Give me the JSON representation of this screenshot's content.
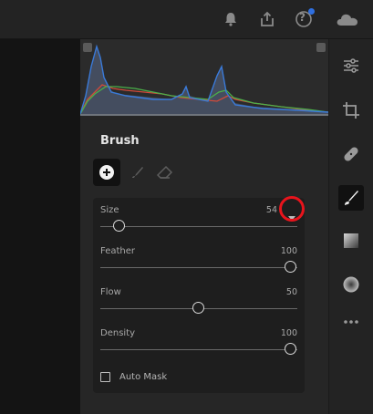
{
  "topbar": {
    "icons": [
      "bell-icon",
      "share-icon",
      "help-icon",
      "cloud-icon"
    ],
    "help_glyph": "?",
    "notification_dot_color": "#2f6fe0"
  },
  "panel": {
    "title": "Brush",
    "tools": [
      "add-brush-icon",
      "brush-paint-icon",
      "eraser-icon"
    ],
    "sliders": [
      {
        "label": "Size",
        "value": "54",
        "level": 0.07
      },
      {
        "label": "Feather",
        "value": "100",
        "level": 1.0
      },
      {
        "label": "Flow",
        "value": "50",
        "level": 0.5
      },
      {
        "label": "Density",
        "value": "100",
        "level": 1.0
      }
    ],
    "auto_mask": {
      "label": "Auto Mask",
      "checked": false
    }
  },
  "rail": {
    "icons": [
      "edit-sliders-icon",
      "crop-icon",
      "heal-icon",
      "brush-icon",
      "gradient-icon",
      "radial-icon",
      "more-icon"
    ],
    "active": "brush-icon"
  },
  "colors": {
    "highlight_ring": "#e8141c",
    "histogram_red": "#d04a3a",
    "histogram_green": "#4bb04a",
    "histogram_blue": "#3a7ad9"
  }
}
